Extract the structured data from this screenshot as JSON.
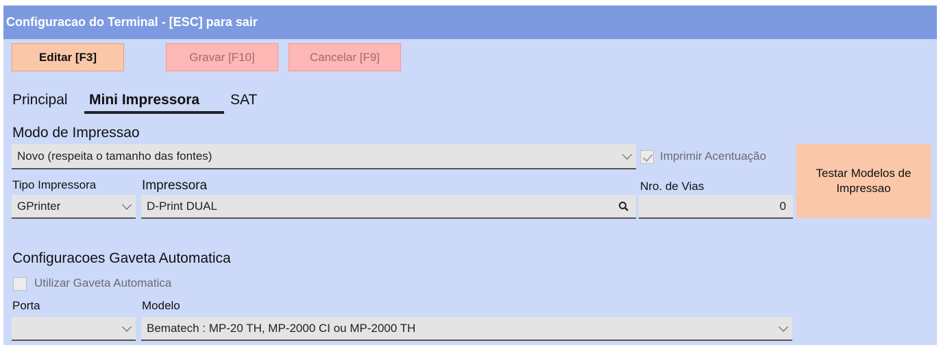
{
  "window": {
    "title": "Configuracao do Terminal - [ESC] para sair"
  },
  "toolbar": {
    "edit_label": "Editar [F3]",
    "save_label": "Gravar [F10]",
    "cancel_label": "Cancelar [F9]"
  },
  "tabs": [
    {
      "label": "Principal",
      "active": false
    },
    {
      "label": "Mini Impressora",
      "active": true
    },
    {
      "label": "SAT",
      "active": false
    }
  ],
  "print_mode": {
    "section_label": "Modo de Impressao",
    "selected": "Novo (respeita o tamanho das fontes)",
    "accent_checkbox_label": "Imprimir Acentuação",
    "accent_checked": true
  },
  "printer": {
    "type_label": "Tipo Impressora",
    "type_value": "GPrinter",
    "printer_label": "Impressora",
    "printer_value": "D-Print DUAL",
    "copies_label": "Nro. de Vias",
    "copies_value": "0",
    "test_button_label": "Testar Modelos de Impressao"
  },
  "drawer": {
    "section_label": "Configuracoes Gaveta Automatica",
    "use_label": "Utilizar Gaveta Automatica",
    "use_checked": false,
    "port_label": "Porta",
    "port_value": "",
    "model_label": "Modelo",
    "model_value": "Bematech : MP-20 TH, MP-2000 CI ou MP-2000 TH"
  },
  "colors": {
    "titlebar": "#7d9ae0",
    "background": "#ccd9f8",
    "primary_button": "#fbc7a9",
    "disabled_button": "#fdb7b4"
  },
  "icons": {
    "search": "search-icon",
    "chevron": "chevron-down-icon",
    "check": "check-icon"
  }
}
